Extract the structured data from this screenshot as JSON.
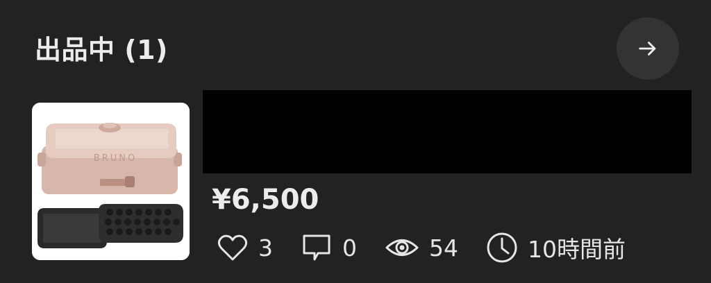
{
  "section": {
    "title": "出品中 (1)"
  },
  "listing": {
    "price": "¥6,500",
    "stats": {
      "likes": "3",
      "comments": "0",
      "views": "54",
      "time": "10時間前"
    }
  },
  "icons": {
    "header_action": "arrow-right-icon",
    "likes": "heart-icon",
    "comments": "comment-icon",
    "views": "eye-icon",
    "time": "clock-icon"
  },
  "colors": {
    "background": "#222222",
    "button_bg": "#333333",
    "text": "#ececec",
    "redaction": "#000000"
  }
}
